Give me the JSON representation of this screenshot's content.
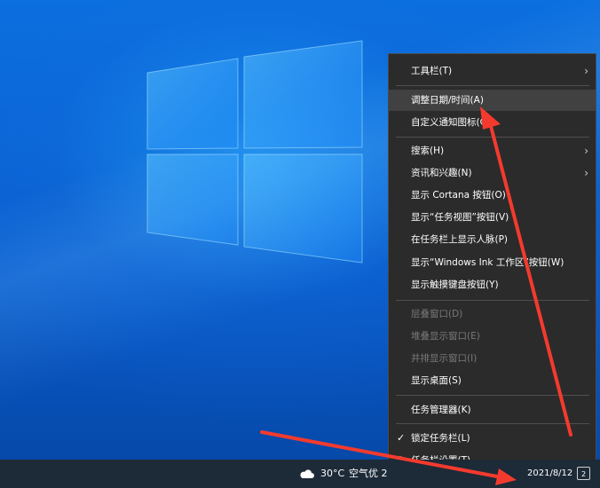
{
  "context_menu": {
    "items": [
      {
        "label": "工具栏(T)",
        "has_submenu": true,
        "state": "normal"
      },
      {
        "label": "调整日期/时间(A)",
        "has_submenu": false,
        "state": "hover"
      },
      {
        "label": "自定义通知图标(C)",
        "has_submenu": false,
        "state": "normal"
      },
      {
        "label": "搜索(H)",
        "has_submenu": true,
        "state": "normal"
      },
      {
        "label": "资讯和兴趣(N)",
        "has_submenu": true,
        "state": "normal"
      },
      {
        "label": "显示 Cortana 按钮(O)",
        "has_submenu": false,
        "state": "normal"
      },
      {
        "label": "显示“任务视图”按钮(V)",
        "has_submenu": false,
        "state": "normal"
      },
      {
        "label": "在任务栏上显示人脉(P)",
        "has_submenu": false,
        "state": "normal"
      },
      {
        "label": "显示“Windows Ink 工作区”按钮(W)",
        "has_submenu": false,
        "state": "normal"
      },
      {
        "label": "显示触摸键盘按钮(Y)",
        "has_submenu": false,
        "state": "normal"
      },
      {
        "label": "层叠窗口(D)",
        "has_submenu": false,
        "state": "disabled"
      },
      {
        "label": "堆叠显示窗口(E)",
        "has_submenu": false,
        "state": "disabled"
      },
      {
        "label": "并排显示窗口(I)",
        "has_submenu": false,
        "state": "disabled"
      },
      {
        "label": "显示桌面(S)",
        "has_submenu": false,
        "state": "normal"
      },
      {
        "label": "任务管理器(K)",
        "has_submenu": false,
        "state": "normal"
      },
      {
        "label": "锁定任务栏(L)",
        "has_submenu": false,
        "state": "checked"
      },
      {
        "label": "任务栏设置(T)",
        "has_submenu": false,
        "state": "settings"
      }
    ],
    "submenu_arrow": "›",
    "check_mark": "✓",
    "settings_glyph": "⚙"
  },
  "taskbar": {
    "weather_icon": "cloud-icon",
    "temperature": "30°C",
    "air_quality": "空气优 2",
    "date": "2021/8/12",
    "notification_badge": "2"
  },
  "annotations": {
    "arrow_color": "#f43a2e"
  },
  "colors": {
    "menu_bg": "#2b2b2b",
    "menu_hover": "#414141",
    "taskbar_bg": "#1d2a37",
    "desktop_blue": "#0a5fc4"
  }
}
